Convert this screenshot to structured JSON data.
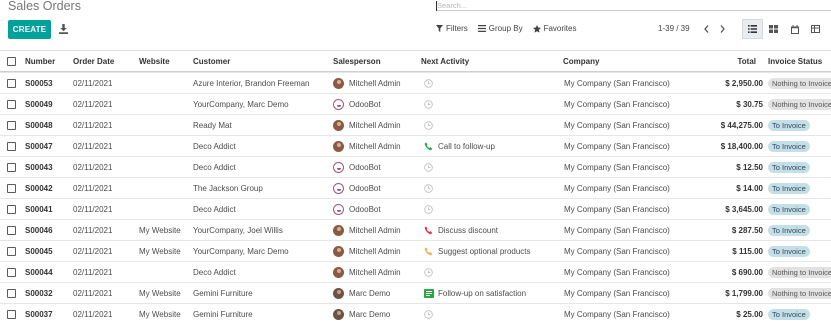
{
  "page": {
    "title": "Sales Orders"
  },
  "search": {
    "placeholder": "Search..."
  },
  "toolbar": {
    "create_label": "CREATE",
    "download_icon": "download-icon"
  },
  "filters": {
    "filters_label": "Filters",
    "groupby_label": "Group By",
    "favorites_label": "Favorites"
  },
  "pager": {
    "text": "1-39 / 39"
  },
  "views": [
    "list-view-icon",
    "kanban-view-icon",
    "calendar-view-icon",
    "pivot-view-icon",
    "graph-view-icon"
  ],
  "columns": {
    "number": "Number",
    "order_date": "Order Date",
    "website": "Website",
    "customer": "Customer",
    "salesperson": "Salesperson",
    "next_activity": "Next Activity",
    "company": "Company",
    "total": "Total",
    "invoice_status": "Invoice Status"
  },
  "colors": {
    "primary": "#00a09d",
    "badge_nothing": "#e2e2e2",
    "badge_to_invoice": "#c5dfe8",
    "activity_call": "#28a745",
    "activity_discuss": "#dc3545",
    "activity_suggest": "#f0ad4e"
  },
  "rows": [
    {
      "number": "S00053",
      "order_date": "02/11/2021",
      "website": "",
      "customer": "Azure Interior, Brandon Freeman",
      "salesperson": "Mitchell Admin",
      "avatar": "mitchell",
      "activity": "",
      "activity_icon": "clock",
      "company": "My Company (San Francisco)",
      "total": "$ 2,950.00",
      "status": "Nothing to Invoice",
      "status_kind": "nothing"
    },
    {
      "number": "S00049",
      "order_date": "02/11/2021",
      "website": "",
      "customer": "YourCompany, Marc Demo",
      "salesperson": "OdooBot",
      "avatar": "odoobot",
      "activity": "",
      "activity_icon": "clock",
      "company": "My Company (San Francisco)",
      "total": "$ 30.75",
      "status": "Nothing to Invoice",
      "status_kind": "nothing"
    },
    {
      "number": "S00048",
      "order_date": "02/11/2021",
      "website": "",
      "customer": "Ready Mat",
      "salesperson": "Mitchell Admin",
      "avatar": "mitchell",
      "activity": "",
      "activity_icon": "clock",
      "company": "My Company (San Francisco)",
      "total": "$ 44,275.00",
      "status": "To Invoice",
      "status_kind": "toinv"
    },
    {
      "number": "S00047",
      "order_date": "02/11/2021",
      "website": "",
      "customer": "Deco Addict",
      "salesperson": "Mitchell Admin",
      "avatar": "mitchell",
      "activity": "Call to follow-up",
      "activity_icon": "phone-green",
      "company": "My Company (San Francisco)",
      "total": "$ 18,400.00",
      "status": "To Invoice",
      "status_kind": "toinv"
    },
    {
      "number": "S00043",
      "order_date": "02/11/2021",
      "website": "",
      "customer": "Deco Addict",
      "salesperson": "OdooBot",
      "avatar": "odoobot",
      "activity": "",
      "activity_icon": "clock",
      "company": "My Company (San Francisco)",
      "total": "$ 12.50",
      "status": "To Invoice",
      "status_kind": "toinv"
    },
    {
      "number": "S00042",
      "order_date": "02/11/2021",
      "website": "",
      "customer": "The Jackson Group",
      "salesperson": "OdooBot",
      "avatar": "odoobot",
      "activity": "",
      "activity_icon": "clock",
      "company": "My Company (San Francisco)",
      "total": "$ 14.00",
      "status": "To Invoice",
      "status_kind": "toinv"
    },
    {
      "number": "S00041",
      "order_date": "02/11/2021",
      "website": "",
      "customer": "Deco Addict",
      "salesperson": "OdooBot",
      "avatar": "odoobot",
      "activity": "",
      "activity_icon": "clock",
      "company": "My Company (San Francisco)",
      "total": "$ 3,645.00",
      "status": "To Invoice",
      "status_kind": "toinv"
    },
    {
      "number": "S00046",
      "order_date": "02/11/2021",
      "website": "My Website",
      "customer": "YourCompany, Joel Willis",
      "salesperson": "Mitchell Admin",
      "avatar": "mitchell",
      "activity": "Discuss discount",
      "activity_icon": "phone-red",
      "company": "My Company (San Francisco)",
      "total": "$ 287.50",
      "status": "To Invoice",
      "status_kind": "toinv"
    },
    {
      "number": "S00045",
      "order_date": "02/11/2021",
      "website": "My Website",
      "customer": "YourCompany, Marc Demo",
      "salesperson": "Mitchell Admin",
      "avatar": "mitchell",
      "activity": "Suggest optional products",
      "activity_icon": "phone-orange",
      "company": "My Company (San Francisco)",
      "total": "$ 115.00",
      "status": "To Invoice",
      "status_kind": "toinv"
    },
    {
      "number": "S00044",
      "order_date": "02/11/2021",
      "website": "",
      "customer": "Deco Addict",
      "salesperson": "Mitchell Admin",
      "avatar": "mitchell",
      "activity": "",
      "activity_icon": "clock",
      "company": "My Company (San Francisco)",
      "total": "$ 690.00",
      "status": "Nothing to Invoice",
      "status_kind": "nothing"
    },
    {
      "number": "S00032",
      "order_date": "02/11/2021",
      "website": "My Website",
      "customer": "Gemini Furniture",
      "salesperson": "Marc Demo",
      "avatar": "marc",
      "activity": "Follow-up on satisfaction",
      "activity_icon": "task-green",
      "company": "My Company (San Francisco)",
      "total": "$ 1,799.00",
      "status": "Nothing to Invoice",
      "status_kind": "nothing"
    },
    {
      "number": "S00037",
      "order_date": "02/11/2021",
      "website": "My Website",
      "customer": "Gemini Furniture",
      "salesperson": "Marc Demo",
      "avatar": "marc",
      "activity": "",
      "activity_icon": "clock",
      "company": "My Company (San Francisco)",
      "total": "$ 25.00",
      "status": "To Invoice",
      "status_kind": "toinv"
    }
  ]
}
